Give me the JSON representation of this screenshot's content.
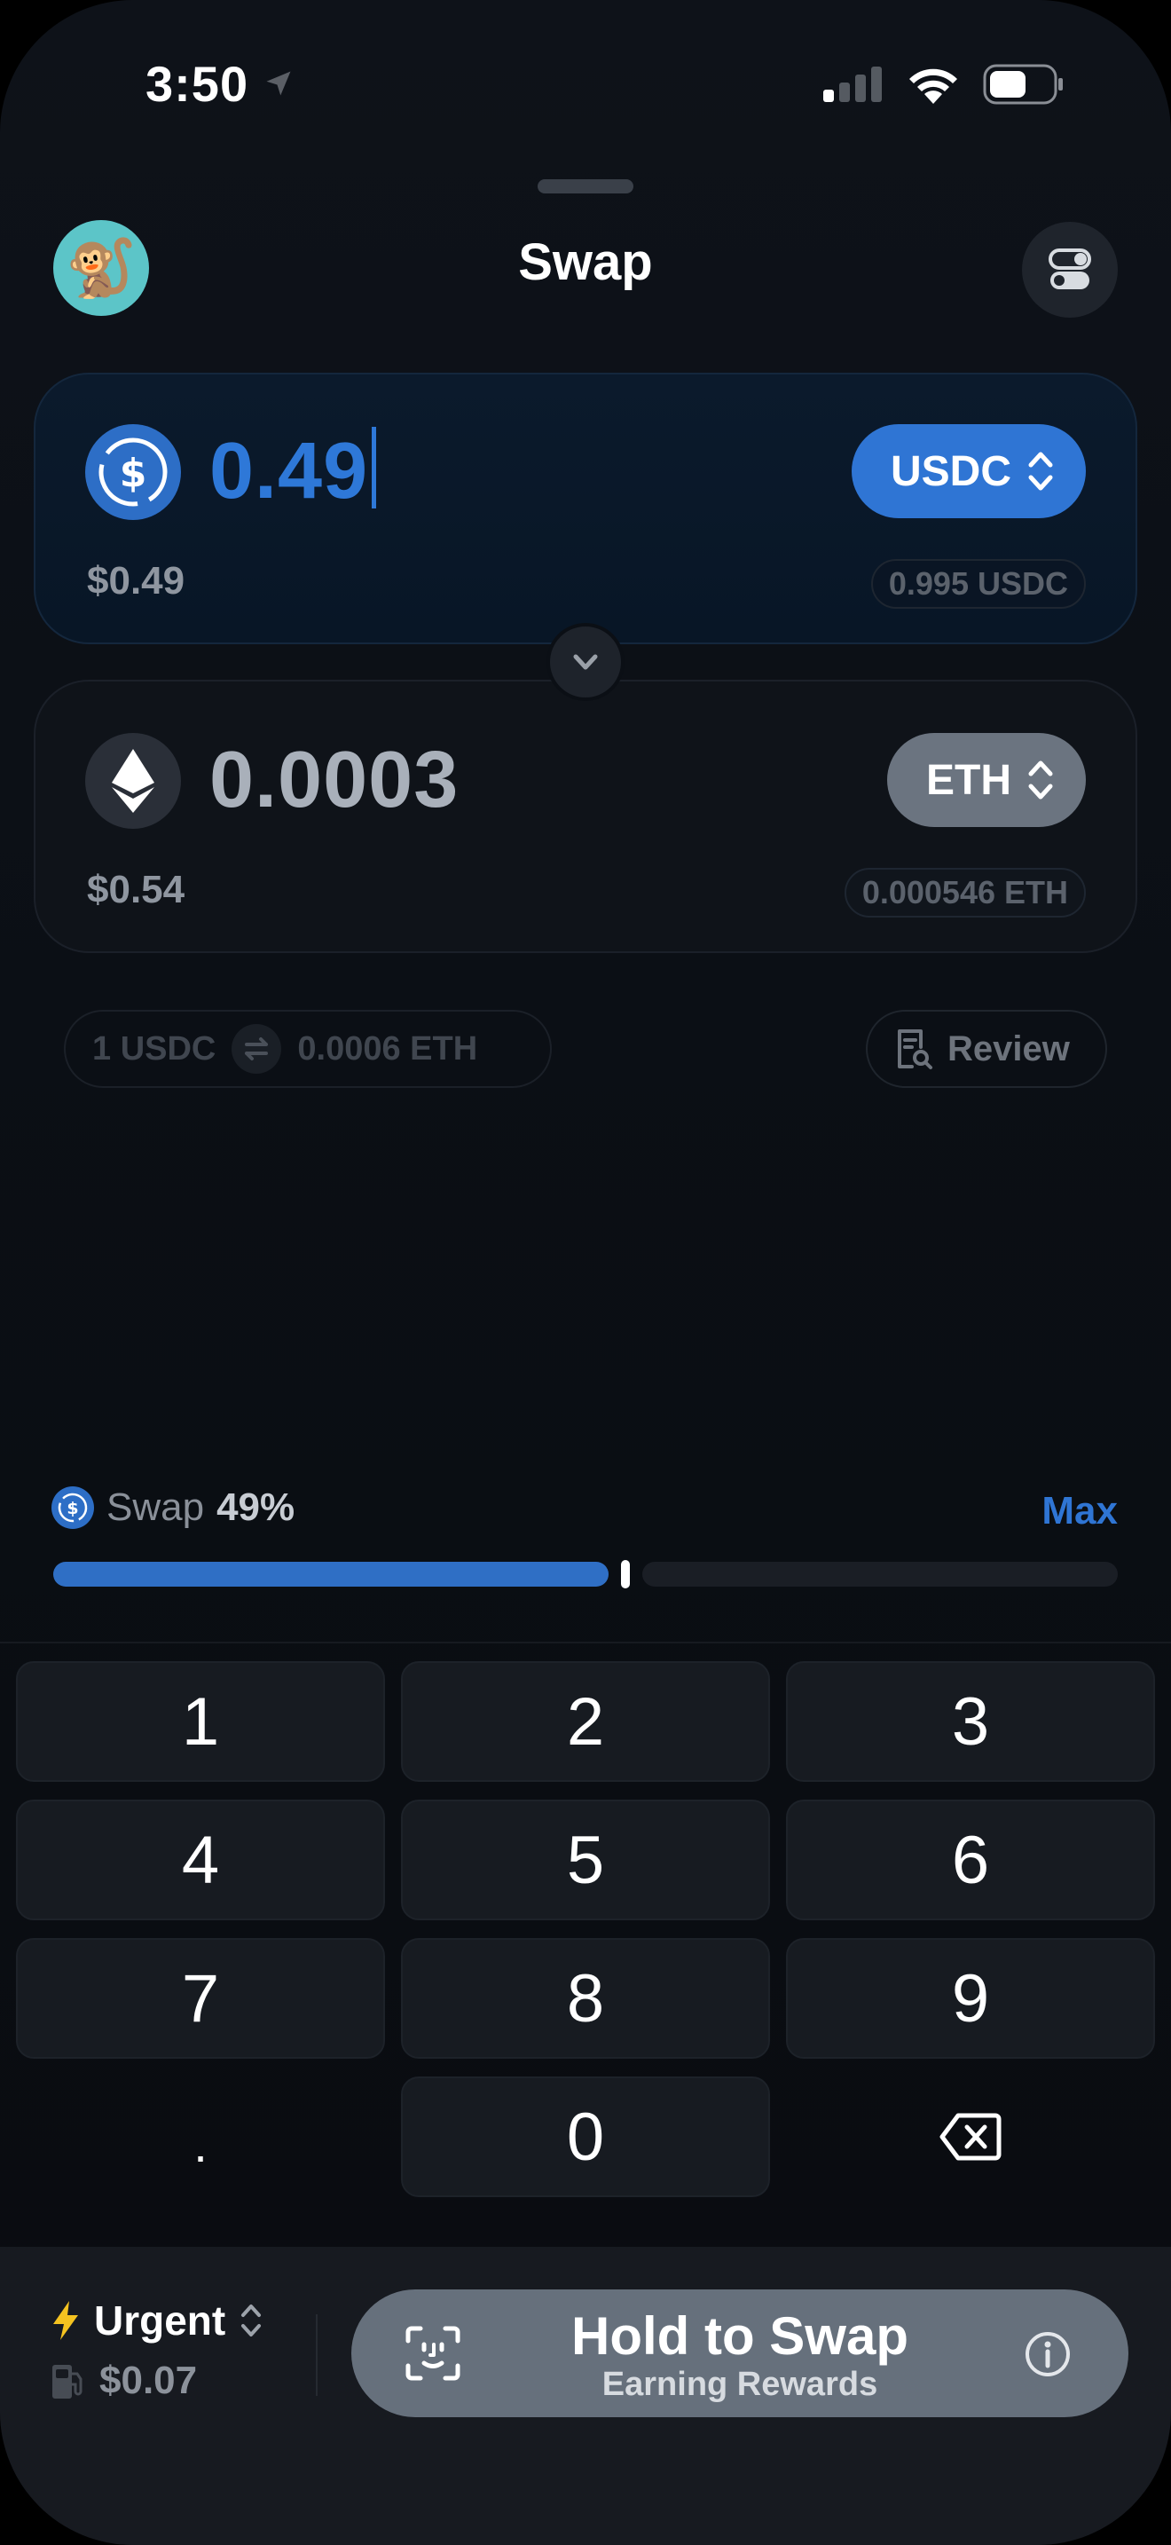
{
  "status": {
    "time": "3:50"
  },
  "header": {
    "title": "Swap",
    "avatar_emoji": "🐒"
  },
  "from": {
    "amount": "0.49",
    "token": "USDC",
    "fiat": "$0.49",
    "balance": "0.995 USDC",
    "icon": "usdc-icon",
    "accent": "#2f75d4"
  },
  "to": {
    "amount": "0.0003",
    "token": "ETH",
    "fiat": "$0.54",
    "balance": "0.000546 ETH",
    "icon": "eth-icon"
  },
  "rate": {
    "left": "1 USDC",
    "right": "0.0006 ETH"
  },
  "review_label": "Review",
  "slider": {
    "label": "Swap",
    "percent_text": "49%",
    "percent": 0.49,
    "max_label": "Max"
  },
  "keypad": {
    "keys": [
      "1",
      "2",
      "3",
      "4",
      "5",
      "6",
      "7",
      "8",
      "9",
      ".",
      "0",
      "⌫"
    ]
  },
  "footer": {
    "speed": "Urgent",
    "fee": "$0.07",
    "button_label": "Hold to Swap",
    "button_sub": "Earning Rewards"
  }
}
